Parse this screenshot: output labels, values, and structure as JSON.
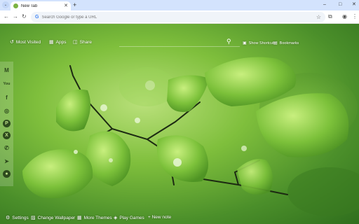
{
  "browser": {
    "tab_title": "New Tab",
    "new_tab_symbol": "+",
    "address_placeholder": "Search Google or type a URL",
    "window_controls": [
      "–",
      "□",
      "✕"
    ]
  },
  "topnav": {
    "most_visited": "Most Visited",
    "apps": "Apps",
    "share": "Share",
    "show_shortcuts": "Show Shortcuts",
    "bookmarks": "Bookmarks"
  },
  "sidebar": {
    "items": [
      {
        "name": "gmail",
        "glyph": "M"
      },
      {
        "name": "youtube",
        "glyph": "You"
      },
      {
        "name": "facebook",
        "glyph": "f"
      },
      {
        "name": "instagram",
        "glyph": "◎"
      },
      {
        "name": "pinterest",
        "glyph": "P"
      },
      {
        "name": "x",
        "glyph": "X"
      },
      {
        "name": "whatsapp",
        "glyph": "✆"
      },
      {
        "name": "telegram",
        "glyph": "➤"
      },
      {
        "name": "reddit",
        "glyph": "●"
      }
    ]
  },
  "bottombar": {
    "settings": "Settings",
    "change_wallpaper": "Change Wallpaper",
    "more_themes": "More Themes",
    "play_games": "Play Games",
    "new_note": "+ New note"
  },
  "colors": {
    "tabstrip": "#d3e3fd",
    "leaf": "#7fbf3c"
  }
}
